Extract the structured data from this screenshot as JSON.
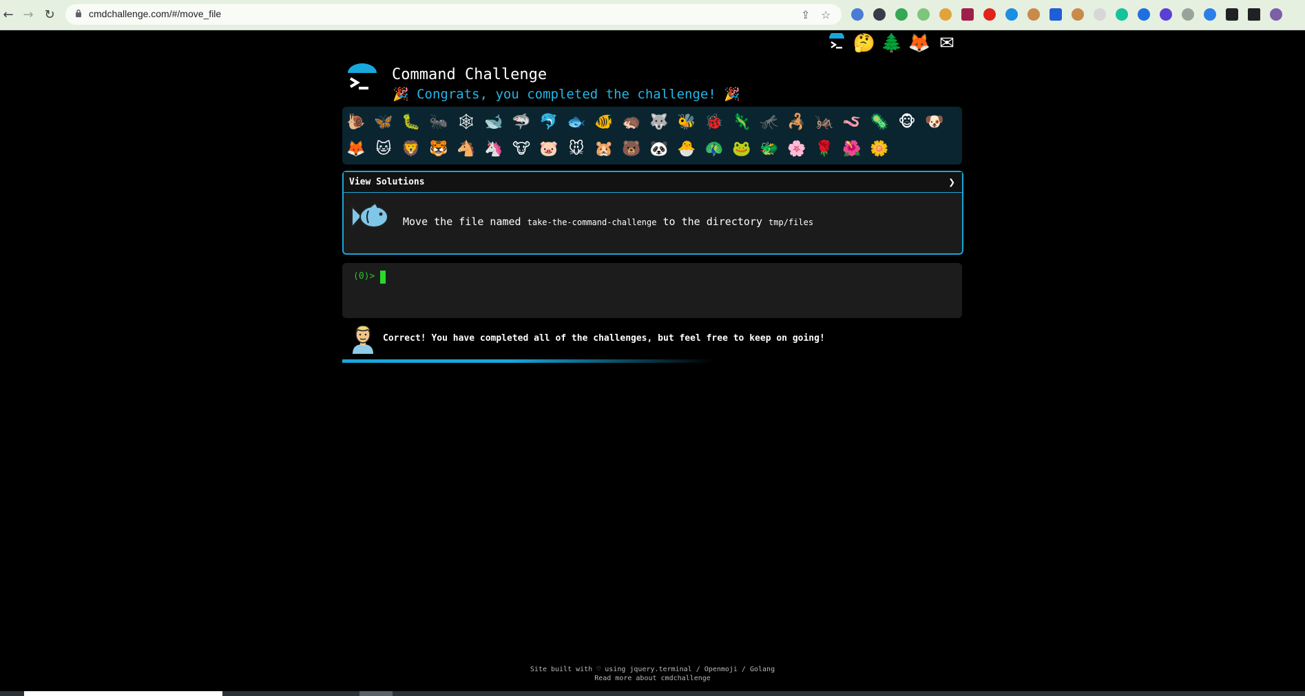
{
  "browser": {
    "url": "cmdchallenge.com/#/move_file"
  },
  "header": {
    "title": "Command Challenge",
    "congrats": "🎉  Congrats, you completed the challenge!  🎉",
    "top_icons": [
      "terminal-logo-icon",
      "thinking-face-icon",
      "evergreen-tree-icon",
      "gitlab-fox-icon",
      "envelope-icon"
    ]
  },
  "animals": {
    "row1": [
      "🐌",
      "🦋",
      "🐛",
      "🐜",
      "🕸",
      "🐋",
      "🦈",
      "🐬",
      "🐟",
      "🐠",
      "🦔",
      "🐺",
      "🐝",
      "🐞",
      "🦎",
      "🦟",
      "🦂",
      "🦗",
      "🪱",
      "🦠",
      "🐵",
      "🐶"
    ],
    "row2": [
      "🦊",
      "🐱",
      "🦁",
      "🐯",
      "🐴",
      "🦄",
      "🐮",
      "🐷",
      "🐭",
      "🐹",
      "🐻",
      "🐼",
      "🐣",
      "🦚",
      "🐸",
      "🐲",
      "🌸",
      "🌹",
      "🌺",
      "🌼"
    ]
  },
  "challenge": {
    "view_solutions": "View Solutions",
    "chevron": "❯",
    "task_prefix": "Move the file named",
    "task_file": "take-the-command-challenge",
    "task_middle": "to the directory",
    "task_dir": "tmp/files"
  },
  "terminal": {
    "prompt": "(0)>"
  },
  "message": {
    "text": "Correct! You have completed all of the challenges, but feel free to keep on going!"
  },
  "footer": {
    "line1": "Site built with ♡ using jquery.terminal / Openmoji / Golang",
    "line2": "Read more about cmdchallenge"
  }
}
